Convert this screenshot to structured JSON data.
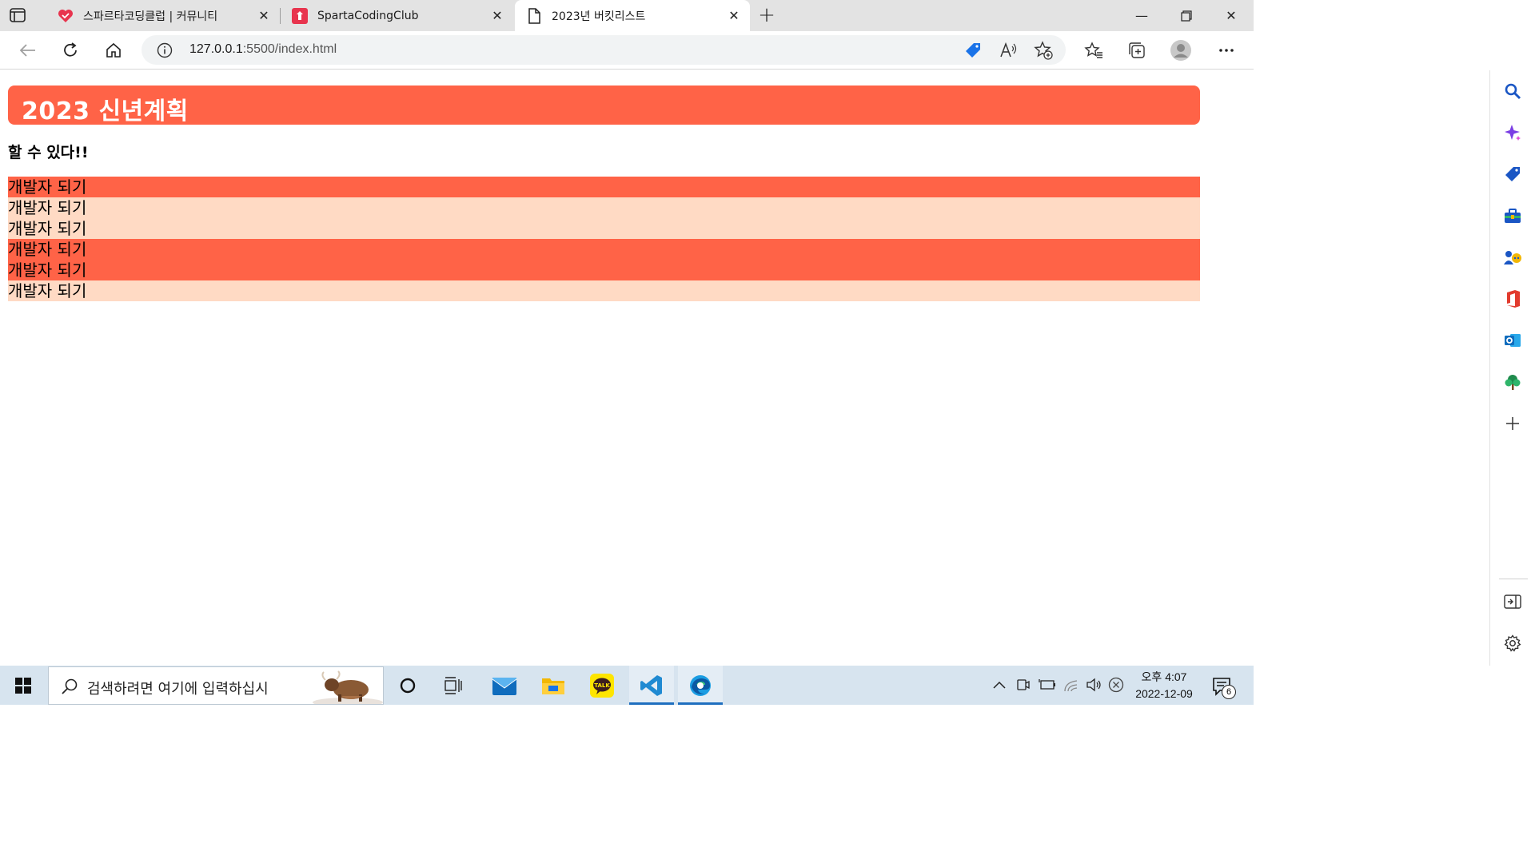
{
  "tabs": [
    {
      "title": "스파르타코딩클럽 | 커뮤니티",
      "icon": "sparta-heart-icon",
      "active": false
    },
    {
      "title": "SpartaCodingClub",
      "icon": "sparta-logo-icon",
      "active": false
    },
    {
      "title": "2023년 버킷리스트",
      "icon": "page-icon",
      "active": true
    }
  ],
  "address": {
    "host": "127.0.0.1",
    "rest": ":5500/index.html"
  },
  "page": {
    "banner_title": "2023 신년계획",
    "subtitle": "할 수 있다!!",
    "items": [
      {
        "text": "개발자 되기",
        "style": "dark"
      },
      {
        "text": "개발자 되기",
        "style": "light"
      },
      {
        "text": "개발자 되기",
        "style": "light"
      },
      {
        "text": "개발자 되기",
        "style": "dark"
      },
      {
        "text": "개발자 되기",
        "style": "dark"
      },
      {
        "text": "개발자 되기",
        "style": "light"
      }
    ]
  },
  "colors": {
    "banner": "#ff6347",
    "row_dark": "#ff6347",
    "row_light": "#ffdac4"
  },
  "taskbar": {
    "search_placeholder": "검색하려면 여기에 입력하십시",
    "clock_time": "오후 4:07",
    "clock_date": "2022-12-09",
    "notification_count": "6"
  }
}
